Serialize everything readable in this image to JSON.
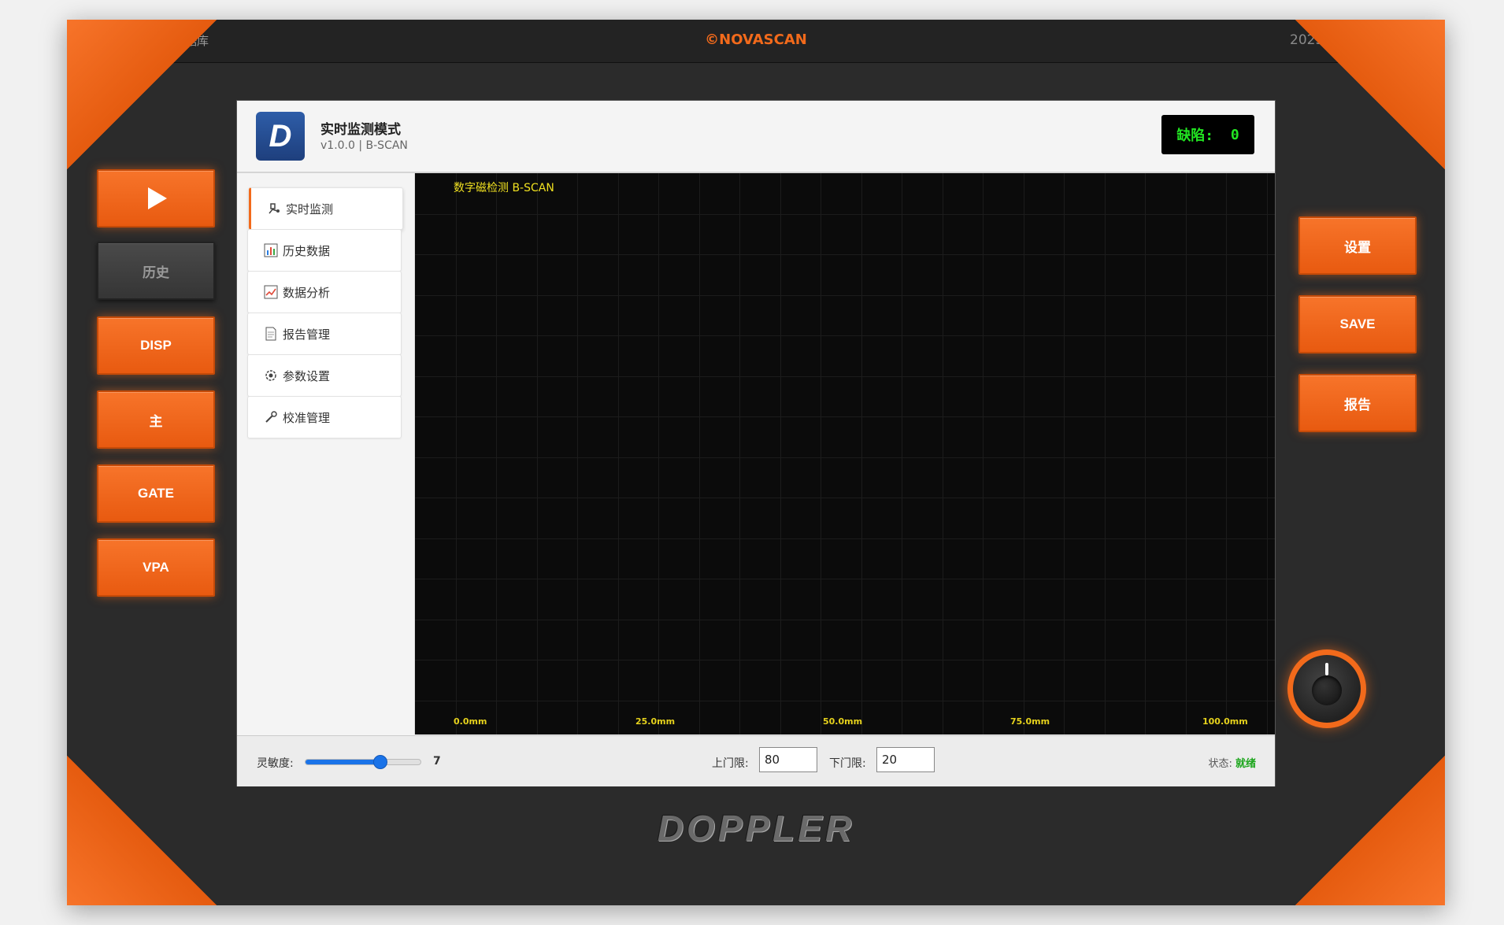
{
  "topbar": {
    "left_text": "据库",
    "center_text": "©NOVASCAN",
    "right_text": "2025"
  },
  "left_buttons": [
    {
      "label": "",
      "icon": "play-icon"
    },
    {
      "label": "历史"
    },
    {
      "label": "DISP"
    },
    {
      "label": "主"
    },
    {
      "label": "GATE"
    },
    {
      "label": "VPA"
    }
  ],
  "right_buttons": [
    {
      "label": "设置"
    },
    {
      "label": "SAVE"
    },
    {
      "label": "报告"
    }
  ],
  "header": {
    "logo_letter": "D",
    "title": "实时监测模式",
    "subtitle": "v1.0.0 | B-SCAN",
    "defect_label": "缺陷:",
    "defect_count": "0"
  },
  "nav": [
    {
      "label": "实时监测",
      "icon": "monitor-icon",
      "active": true
    },
    {
      "label": "历史数据",
      "icon": "bar-chart-icon"
    },
    {
      "label": "数据分析",
      "icon": "line-chart-icon"
    },
    {
      "label": "报告管理",
      "icon": "document-icon"
    },
    {
      "label": "参数设置",
      "icon": "gear-icon"
    },
    {
      "label": "校准管理",
      "icon": "wrench-icon"
    }
  ],
  "scan": {
    "title": "数字磁检测 B-SCAN",
    "x_ticks": [
      "0.0mm",
      "25.0mm",
      "50.0mm",
      "75.0mm",
      "100.0mm"
    ]
  },
  "controls": {
    "sensitivity_label": "灵敏度:",
    "sensitivity_value": "7",
    "sensitivity_fraction": 0.65,
    "upper_gate_label": "上门限:",
    "upper_gate_value": "80",
    "lower_gate_label": "下门限:",
    "lower_gate_value": "20",
    "status_label": "状态:",
    "status_value": "就绪"
  },
  "brand": "DOPPLER",
  "colors": {
    "accent": "#f26a1b",
    "scan_bg": "#0b0b0b",
    "defect_text": "#22e622",
    "status_ok": "#1aa51a"
  }
}
